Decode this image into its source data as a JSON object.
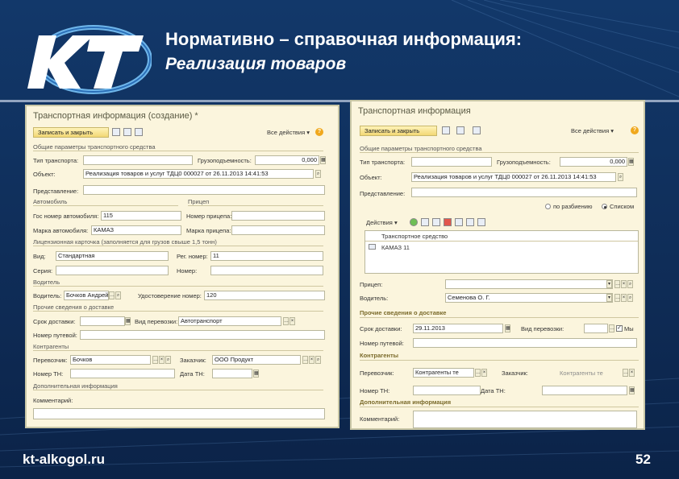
{
  "slide": {
    "title": "Нормативно – справочная информация:",
    "subtitle": "Реализация товаров",
    "footer_site": "kt-alkogol.ru",
    "page_number": "52"
  },
  "left_window": {
    "title": "Транспортная информация (создание) *",
    "btn_save_close": "Записать и закрыть",
    "all_actions": "Все действия ▾",
    "sec_general": "Общие параметры транспортного средства",
    "lbl_transport_type": "Тип транспорта:",
    "lbl_capacity": "Грузоподъемность:",
    "val_capacity": "0,000",
    "lbl_object": "Объект:",
    "val_object": "Реализация товаров и услуг ТДЦ0 000027 от 26.11.2013 14:41:53",
    "lbl_representation": "Представление:",
    "sec_auto": "Автомобиль",
    "sec_trailer": "Прицеп",
    "lbl_car_number": "Гос номер автомобиля:",
    "val_car_number": "115",
    "lbl_trailer_number": "Номер прицепа:",
    "lbl_car_brand": "Марка автомобиля:",
    "val_car_brand": "КАМАЗ",
    "lbl_trailer_brand": "Марка прицепа:",
    "sec_license": "Лицензионная карточка (заполняется для грузов свыше 1,5 тонн)",
    "lbl_kind": "Вид:",
    "val_kind": "Стандартная",
    "lbl_reg_number": "Рег. номер:",
    "val_reg_number": "11",
    "lbl_series": "Серия:",
    "lbl_number": "Номер:",
    "sec_driver": "Водитель",
    "lbl_driver": "Водитель:",
    "val_driver": "Бочков Андрей",
    "lbl_license": "Удостоверение номер:",
    "val_license": "120",
    "sec_delivery": "Прочие сведения о доставке",
    "lbl_delivery_date": "Срок доставки:",
    "lbl_transport_kind": "Вид перевозки:",
    "val_transport_kind": "Автотранспорт",
    "lbl_route_number": "Номер путевой:",
    "sec_counterparties": "Контрагенты",
    "lbl_carrier": "Перевозчик:",
    "val_carrier": "Бочков",
    "lbl_customer": "Заказчик:",
    "val_customer": "ООО Продукт",
    "lbl_tn_number": "Номер ТН:",
    "lbl_tn_date": "Дата ТН:",
    "sec_additional": "Дополнительная информация",
    "lbl_comment": "Комментарий:"
  },
  "right_window": {
    "title": "Транспортная информация",
    "btn_save_close": "Записать и закрыть",
    "all_actions": "Все действия ▾",
    "sec_general": "Общие параметры транспортного средства",
    "lbl_transport_type": "Тип транспорта:",
    "lbl_capacity": "Грузоподъемность:",
    "val_capacity": "0,000",
    "lbl_object": "Объект:",
    "val_object": "Реализация товаров и услуг ТДЦ0 000027 от 26.11.2013 14:41:53",
    "lbl_representation": "Представление:",
    "radio_breakdown": "по разбиению",
    "radio_list": "Списком",
    "table_actions": "Действия ▾",
    "col_vehicle": "Транспортное средство",
    "row_vehicle": "КАМАЗ 11",
    "lbl_trailer": "Прицеп:",
    "lbl_driver": "Водитель:",
    "val_driver": "Семенова О. Г.",
    "sec_delivery": "Прочие сведения о доставке",
    "lbl_delivery_date": "Срок доставки:",
    "val_delivery_date": "29.11.2013",
    "lbl_transport_kind": "Вид перевозки:",
    "lbl_route": "Номер путевой:",
    "sec_counterparties": "Контрагенты",
    "lbl_carrier": "Перевозчик:",
    "val_carrier": "Контрагенты те",
    "lbl_customer": "Заказчик:",
    "val_customer": "Контрагенты те",
    "lbl_tn_number": "Номер ТН:",
    "lbl_tn_date": "Дата ТН:",
    "sec_additional": "Дополнительная информация",
    "lbl_comment": "Комментарий:"
  },
  "icons": {
    "logo": "kt-logo",
    "save": "floppy-icon",
    "help": "help-icon"
  },
  "colors": {
    "background": "#12386a",
    "form": "#fbf5dd",
    "button": "#f2d774",
    "section_accent": "#7a6a2a"
  }
}
